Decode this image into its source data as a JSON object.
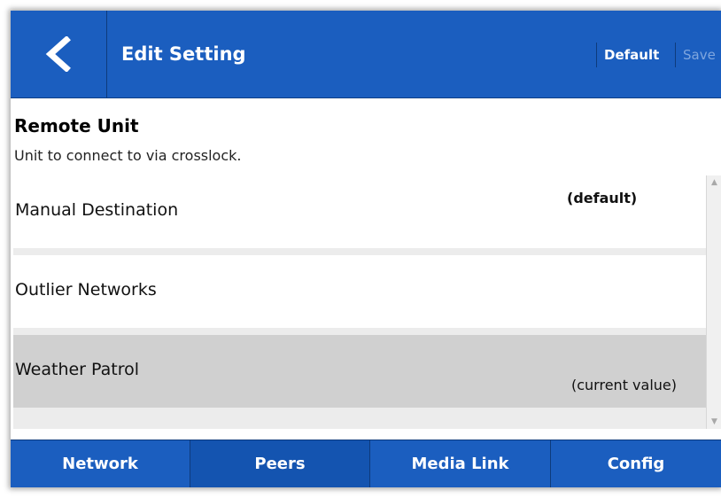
{
  "header": {
    "title": "Edit Setting",
    "back_icon": "chevron-left-icon",
    "default_label": "Default",
    "save_label": "Save"
  },
  "setting": {
    "name": "Remote Unit",
    "description": "Unit to connect to via crosslock."
  },
  "options": [
    {
      "label": "Manual Destination",
      "badge": "(default)"
    },
    {
      "label": "Outlier Networks",
      "badge": ""
    },
    {
      "label": "Weather Patrol",
      "badge": "(current value)"
    }
  ],
  "nav": {
    "tabs": [
      {
        "label": "Network"
      },
      {
        "label": "Peers"
      },
      {
        "label": "Media Link"
      },
      {
        "label": "Config"
      }
    ],
    "selected": "Peers"
  },
  "colors": {
    "brand_blue": "#1b5ebf",
    "selected_row": "#d0d0d0"
  }
}
